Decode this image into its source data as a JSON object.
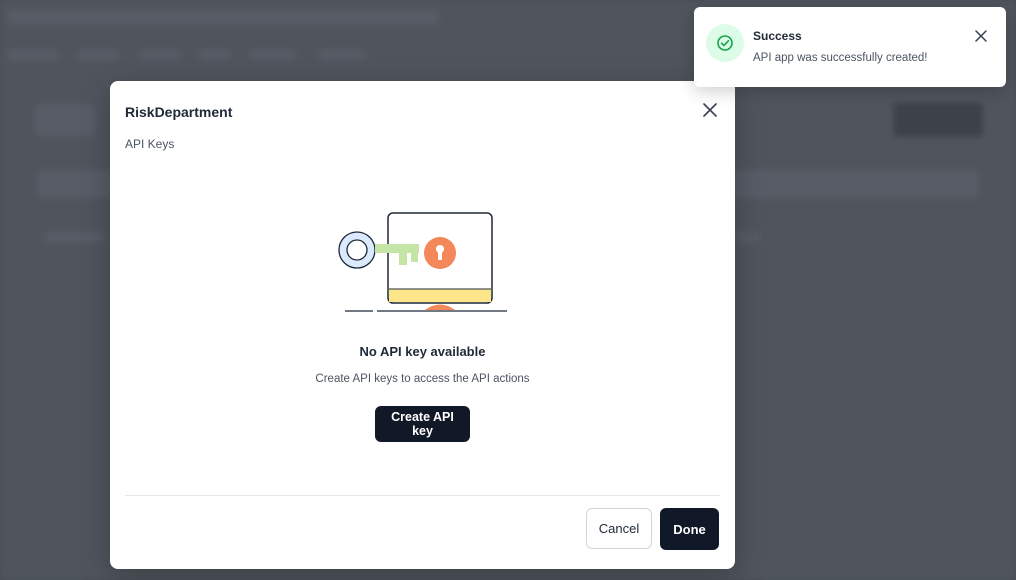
{
  "modal": {
    "title": "RiskDepartment",
    "subtitle": "API Keys",
    "empty_title": "No API key available",
    "empty_description": "Create API keys to access the API actions",
    "create_button": "Create API key",
    "cancel_button": "Cancel",
    "done_button": "Done",
    "close_icon": "close-icon",
    "illustration": "key-and-lock-illustration"
  },
  "toast": {
    "title": "Success",
    "message": "API app was successfully created!",
    "icon": "check-circle-icon",
    "close_icon": "close-icon",
    "accent_color": "#16a34a"
  },
  "colors": {
    "primary_button": "#111827",
    "backdrop": "#4a4e56",
    "illustration_orange": "#f4885a",
    "illustration_green": "#c4e5a6",
    "illustration_blue": "#dbeafe",
    "illustration_yellow": "#fde68a"
  }
}
